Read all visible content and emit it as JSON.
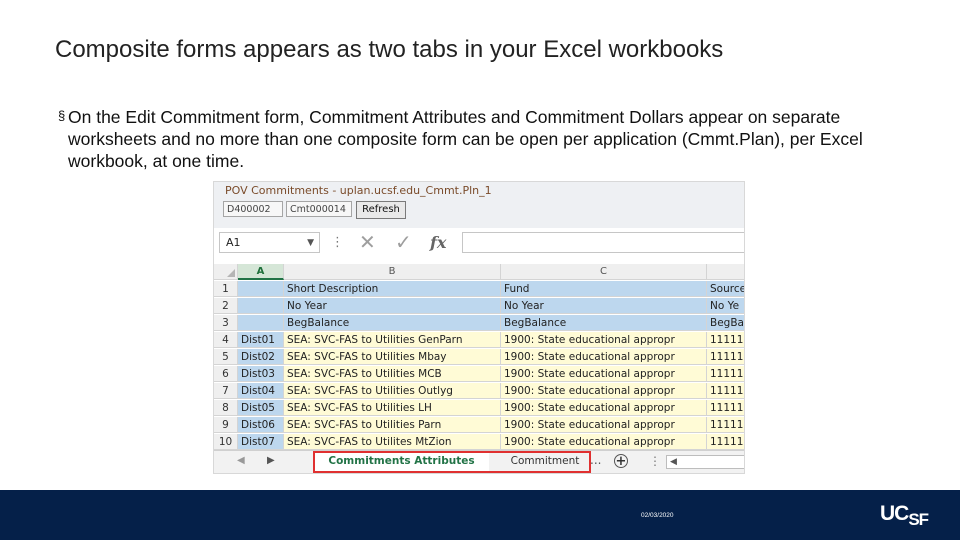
{
  "slide": {
    "title": "Composite forms appears as two tabs in your Excel workbooks",
    "bullet_mark": "§",
    "bullet": "On the Edit Commitment form, Commitment Attributes and Commitment Dollars appear on separate worksheets  and no more than one composite form can be open per application (Cmmt.Plan), per Excel workbook, at one time."
  },
  "pov": {
    "title": "POV Commitments - uplan.ucsf.edu_Cmmt.Pln_1",
    "field1": "D400002",
    "field2": "Cmt000014",
    "refresh_label": "Refresh"
  },
  "formula_bar": {
    "name_box": "A1",
    "name_box_arrow": "▼",
    "more_icon": "⋮",
    "cancel_glyph": "✕",
    "enter_glyph": "✓",
    "fx_label": "fx",
    "formula": ""
  },
  "sheet": {
    "columns": [
      "A",
      "B",
      "C",
      ""
    ],
    "rows": [
      {
        "num": "1",
        "a": "",
        "b": "Short Description",
        "c": "Fund",
        "d": "Source"
      },
      {
        "num": "2",
        "a": "",
        "b": "No Year",
        "c": "No Year",
        "d": "No Ye"
      },
      {
        "num": "3",
        "a": "",
        "b": "BegBalance",
        "c": "BegBalance",
        "d": "BegBa"
      },
      {
        "num": "4",
        "a": "Dist01",
        "b": "SEA: SVC-FAS to Utilities GenParn",
        "c": "1900: State educational appropr",
        "d": "11111"
      },
      {
        "num": "5",
        "a": "Dist02",
        "b": "SEA: SVC-FAS to Utilities Mbay",
        "c": "1900: State educational appropr",
        "d": "11111"
      },
      {
        "num": "6",
        "a": "Dist03",
        "b": "SEA: SVC-FAS to Utilities MCB",
        "c": "1900: State educational appropr",
        "d": "11111"
      },
      {
        "num": "7",
        "a": "Dist04",
        "b": "SEA: SVC-FAS to Utilities Outlyg",
        "c": "1900: State educational appropr",
        "d": "11111"
      },
      {
        "num": "8",
        "a": "Dist05",
        "b": "SEA: SVC-FAS to Utilities LH",
        "c": "1900: State educational appropr",
        "d": "11111"
      },
      {
        "num": "9",
        "a": "Dist06",
        "b": "SEA: SVC-FAS to Utilities Parn",
        "c": "1900: State educational appropr",
        "d": "11111"
      },
      {
        "num": "10",
        "a": "Dist07",
        "b": "SEA: SVC-FAS to Utilites MtZion",
        "c": "1900: State educational appropr",
        "d": "11111"
      }
    ]
  },
  "tabs": {
    "nav_prev": "◀",
    "nav_next": "▶",
    "active": "Commitments Attributes",
    "other": "Commitment",
    "ellipsis": "...",
    "add": "+",
    "more": "⋮",
    "scroll_left": "◀"
  },
  "footer": {
    "date": "02/03/2020",
    "logo_uc": "UC",
    "logo_sf": "SF",
    "colors": {
      "background": "#052049",
      "text": "#ffffff"
    }
  },
  "colors": {
    "header_blue": "#bdd7ee",
    "data_yellow": "#fffbd6",
    "excel_green": "#217346",
    "highlight_red": "#e03030"
  }
}
